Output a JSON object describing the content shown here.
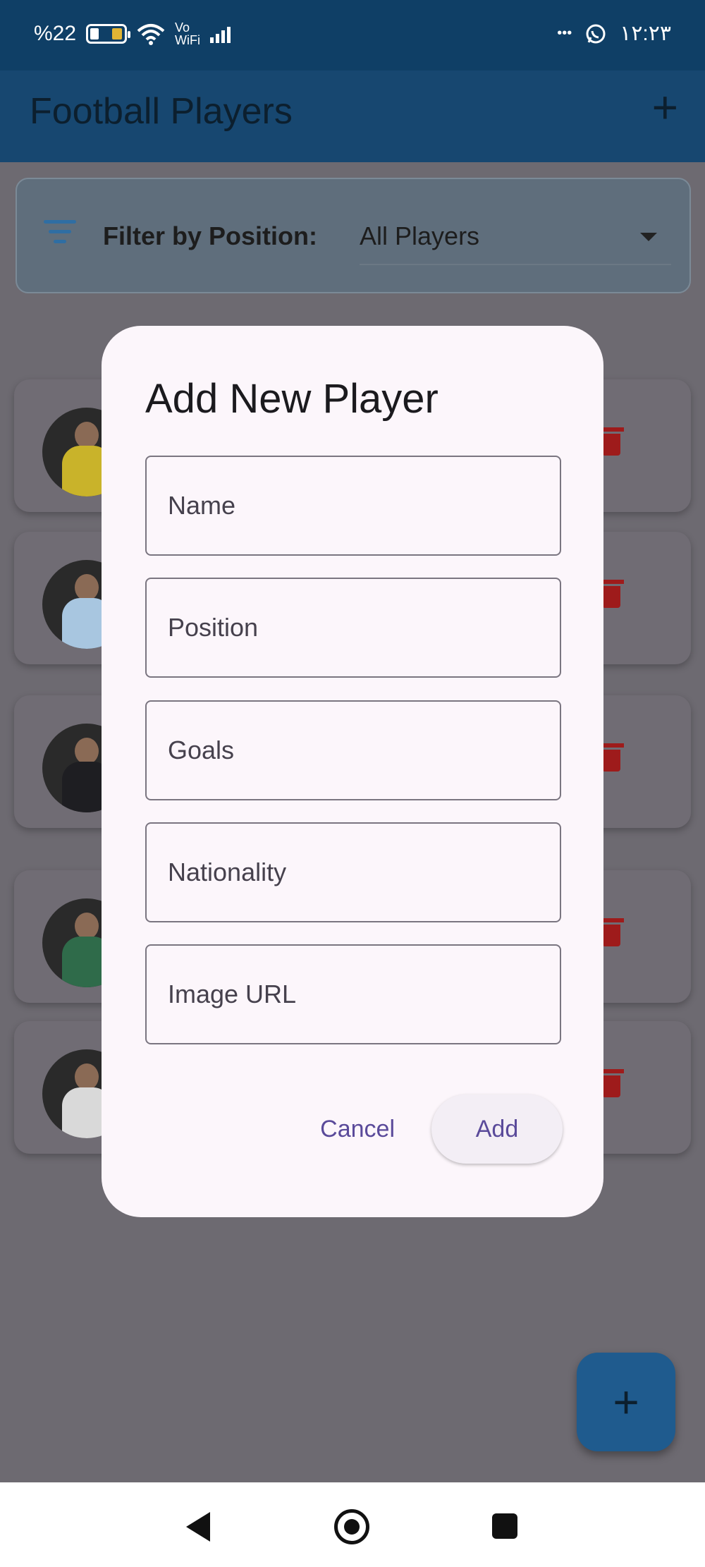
{
  "status_bar": {
    "battery_text": "%22",
    "wifi_label_top": "Vo",
    "wifi_label_bottom": "WiFi",
    "more_dots": "•••",
    "time": "۱۲:۲۳",
    "icons": [
      "battery-icon",
      "wifi-icon",
      "signal-icon",
      "whatsapp-icon"
    ]
  },
  "app_bar": {
    "title": "Football Players",
    "add_symbol": "+"
  },
  "filter": {
    "label": "Filter by Position:",
    "value": "All Players"
  },
  "players": [
    {
      "shirt_color": "#c9b32a"
    },
    {
      "shirt_color": "#a8c6e0"
    },
    {
      "shirt_color": "#1e1e22"
    },
    {
      "shirt_color": "#2f6b4a"
    },
    {
      "shirt_color": "#d9d9d9"
    }
  ],
  "dialog": {
    "title": "Add New Player",
    "fields": {
      "name": "Name",
      "position": "Position",
      "goals": "Goals",
      "nationality": "Nationality",
      "image_url": "Image URL"
    },
    "cancel_label": "Cancel",
    "add_label": "Add"
  },
  "fab": {
    "symbol": "+"
  },
  "colors": {
    "primary_bar": "#0f3f66",
    "scrim": "#6d6a71",
    "dialog_bg": "#fcf6fb",
    "accent_text": "#5a4a9a",
    "delete": "#9e1b1b"
  }
}
